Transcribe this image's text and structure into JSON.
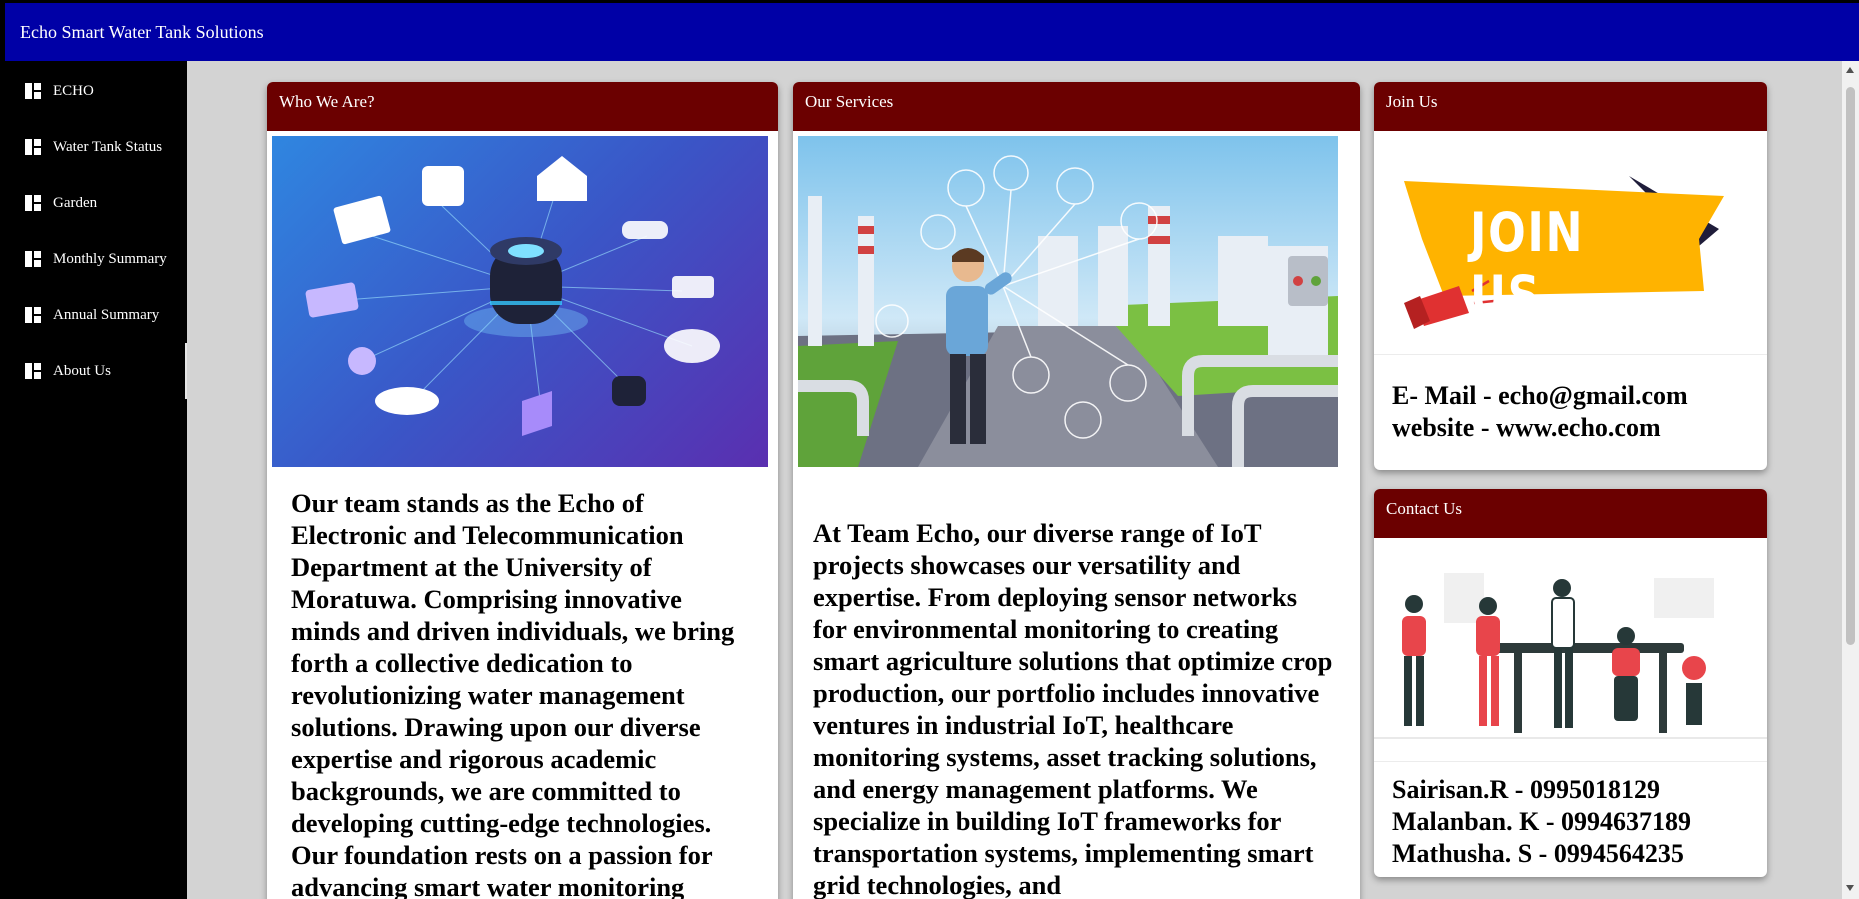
{
  "header": {
    "title": "Echo Smart Water Tank Solutions"
  },
  "sidebar": {
    "items": [
      {
        "label": "ECHO",
        "icon": "dashboard-icon"
      },
      {
        "label": "Water Tank Status",
        "icon": "dashboard-icon"
      },
      {
        "label": "Garden",
        "icon": "dashboard-icon"
      },
      {
        "label": "Monthly Summary",
        "icon": "dashboard-icon"
      },
      {
        "label": "Annual Summary",
        "icon": "dashboard-icon"
      },
      {
        "label": "About Us",
        "icon": "dashboard-icon",
        "active": true
      }
    ]
  },
  "who": {
    "title": "Who We Are?",
    "text": "Our team stands as the Echo of Electronic and Telecommunication Department at the University of Moratuwa. Comprising innovative minds and driven individuals, we bring forth a collective dedication to revolutionizing water management solutions. Drawing upon our diverse expertise and rigorous academic backgrounds, we are committed to developing cutting-edge technologies. Our foundation rests on a passion for advancing smart water monitoring"
  },
  "services": {
    "title": "Our Services",
    "text": "At Team Echo, our diverse range of IoT projects showcases our versatility and expertise. From deploying sensor networks for environmental monitoring to creating smart agriculture solutions that optimize crop production, our portfolio includes innovative ventures in industrial IoT, healthcare monitoring systems, asset tracking solutions, and energy management platforms. We specialize in building IoT frameworks for transportation systems, implementing smart grid technologies, and"
  },
  "join": {
    "title": "Join Us",
    "banner_text": "JOIN US",
    "email": "E- Mail - echo@gmail.com",
    "website": "website - www.echo.com"
  },
  "contact": {
    "title": "Contact Us",
    "people": [
      "Sairisan.R - 0995018129",
      "Malanban. K - 0994637189",
      "Mathusha. S - 0994564235"
    ]
  },
  "colors": {
    "topbar": "#0000a6",
    "card_header": "#6b0000",
    "sidebar": "#000000",
    "banner_yellow": "#ffb300"
  }
}
